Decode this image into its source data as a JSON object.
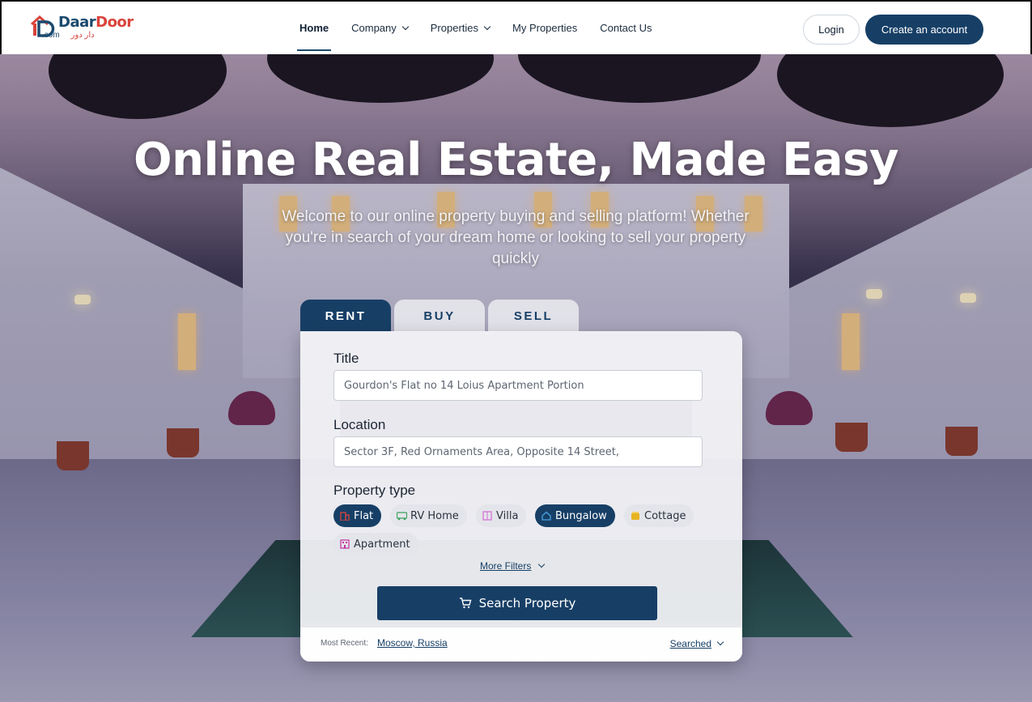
{
  "brand": {
    "name_part1": "Daar",
    "name_part2": "Door",
    "domain": ".com",
    "arabic": "دار دور"
  },
  "nav": {
    "items": [
      {
        "label": "Home",
        "active": true,
        "dropdown": false
      },
      {
        "label": "Company",
        "active": false,
        "dropdown": true
      },
      {
        "label": "Properties",
        "active": false,
        "dropdown": true
      },
      {
        "label": "My Properties",
        "active": false,
        "dropdown": false
      },
      {
        "label": "Contact Us",
        "active": false,
        "dropdown": false
      }
    ],
    "login_label": "Login",
    "create_account_label": "Create an account"
  },
  "hero": {
    "title": "Online Real Estate, Made Easy",
    "subtitle": "Welcome to our online property buying and selling platform! Whether you're in search of your dream home or looking to sell your property quickly"
  },
  "search": {
    "tabs": [
      {
        "label": "RENT",
        "active": true
      },
      {
        "label": "BUY",
        "active": false
      },
      {
        "label": "SELL",
        "active": false
      }
    ],
    "title_label": "Title",
    "title_value": "Gourdon's Flat no 14 Loius Apartment Portion",
    "location_label": "Location",
    "location_value": "Sector 3F, Red Ornaments Area, Opposite 14 Street,",
    "property_type_label": "Property type",
    "property_types": [
      {
        "label": "Flat",
        "selected": true,
        "icon": "building-icon",
        "color": "#d9443b"
      },
      {
        "label": "RV Home",
        "selected": false,
        "icon": "rv-icon",
        "color": "#3aa05a"
      },
      {
        "label": "Villa",
        "selected": false,
        "icon": "villa-icon",
        "color": "#d46ad4"
      },
      {
        "label": "Bungalow",
        "selected": true,
        "icon": "house-icon",
        "color": "#4aa3e0"
      },
      {
        "label": "Cottage",
        "selected": false,
        "icon": "cottage-icon",
        "color": "#e6b422"
      },
      {
        "label": "Apartment",
        "selected": false,
        "icon": "apartment-icon",
        "color": "#c1309c"
      }
    ],
    "more_filters_label": "More Filters",
    "search_button_label": "Search Property",
    "most_recent_label": "Most Recent:",
    "most_recent_value": "Moscow, Russia",
    "searched_label": "Searched"
  },
  "colors": {
    "primary": "#173f66",
    "accent": "#d9443b"
  }
}
